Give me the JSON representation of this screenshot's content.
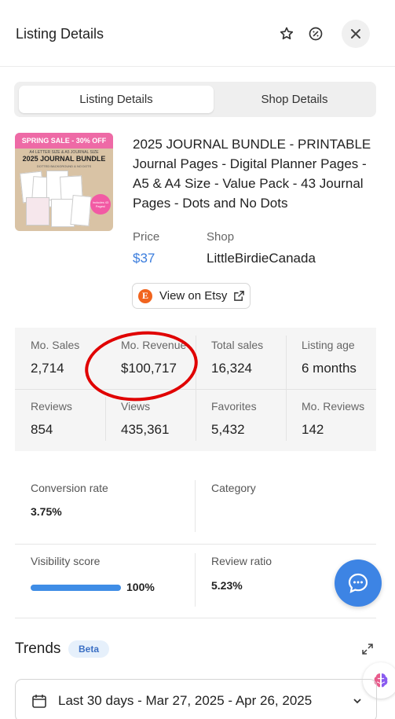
{
  "header": {
    "title": "Listing Details",
    "icons": [
      "star-icon",
      "percent-badge-icon",
      "close-icon"
    ]
  },
  "tabs": [
    {
      "label": "Listing Details",
      "active": true
    },
    {
      "label": "Shop Details",
      "active": false
    }
  ],
  "thumbnail": {
    "banner": "SPRING SALE - 30% OFF",
    "subtitle": "A4 LETTER SIZE & A5 JOURNAL SIZE",
    "title": "2025 JOURNAL BUNDLE",
    "subtitle2": "DOTTED BACKGROUND & NO DOTS",
    "badge": "Includes 43 Pages!"
  },
  "listing": {
    "title": "2025 JOURNAL BUNDLE - PRINTABLE Journal Pages - Digital Planner Pages - A5 & A4 Size - Value Pack - 43 Journal Pages - Dots and No Dots",
    "price_label": "Price",
    "price": "$37",
    "shop_label": "Shop",
    "shop": "LittleBirdieCanada",
    "etsy_button": "View on Etsy",
    "etsy_logo": "E"
  },
  "stats": [
    {
      "label": "Mo. Sales",
      "value": "2,714"
    },
    {
      "label": "Mo. Revenue",
      "value": "$100,717"
    },
    {
      "label": "Total sales",
      "value": "16,324"
    },
    {
      "label": "Listing age",
      "value": "6 months"
    },
    {
      "label": "Reviews",
      "value": "854"
    },
    {
      "label": "Views",
      "value": "435,361"
    },
    {
      "label": "Favorites",
      "value": "5,432"
    },
    {
      "label": "Mo. Reviews",
      "value": "142"
    }
  ],
  "metrics": {
    "conversion_label": "Conversion rate",
    "conversion_value": "3.75%",
    "category_label": "Category",
    "category_value": "",
    "visibility_label": "Visibility score",
    "visibility_value": "100%",
    "visibility_fraction": 1.0,
    "review_ratio_label": "Review ratio",
    "review_ratio_value": "5.23%"
  },
  "trends": {
    "title": "Trends",
    "badge": "Beta"
  },
  "date_range": {
    "label": "Last 30 days - Mar 27, 2025 - Apr 26, 2025"
  },
  "colors": {
    "accent_blue": "#3b7ddd",
    "etsy_orange": "#f1641e",
    "annotation_red": "#e00000"
  }
}
